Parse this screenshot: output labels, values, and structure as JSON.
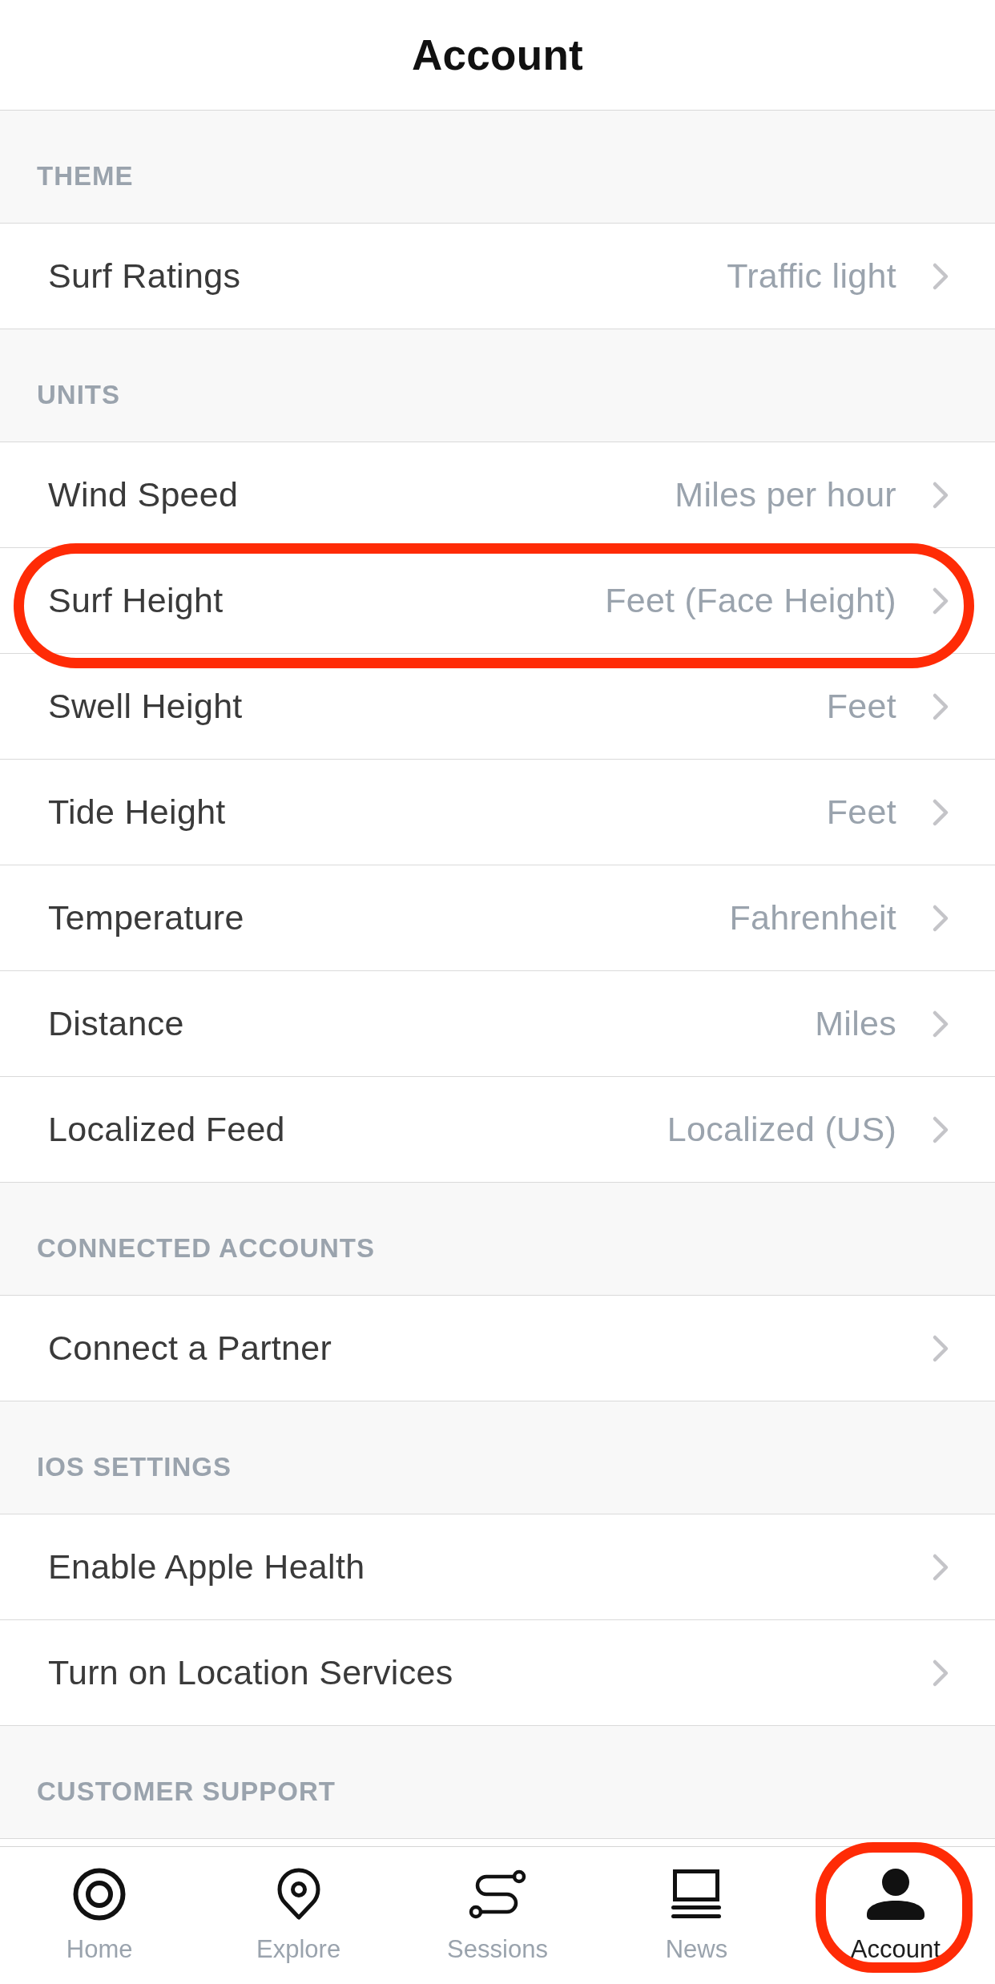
{
  "header": {
    "title": "Account"
  },
  "sections": [
    {
      "title": "THEME",
      "rows": [
        {
          "label": "Surf Ratings",
          "value": "Traffic light",
          "highlighted": false
        }
      ]
    },
    {
      "title": "UNITS",
      "rows": [
        {
          "label": "Wind Speed",
          "value": "Miles per hour",
          "highlighted": false
        },
        {
          "label": "Surf Height",
          "value": "Feet (Face Height)",
          "highlighted": true
        },
        {
          "label": "Swell Height",
          "value": "Feet",
          "highlighted": false
        },
        {
          "label": "Tide Height",
          "value": "Feet",
          "highlighted": false
        },
        {
          "label": "Temperature",
          "value": "Fahrenheit",
          "highlighted": false
        },
        {
          "label": "Distance",
          "value": "Miles",
          "highlighted": false
        },
        {
          "label": "Localized Feed",
          "value": "Localized (US)",
          "highlighted": false
        }
      ]
    },
    {
      "title": "CONNECTED ACCOUNTS",
      "rows": [
        {
          "label": "Connect a Partner",
          "highlighted": false
        }
      ]
    },
    {
      "title": "IOS SETTINGS",
      "rows": [
        {
          "label": "Enable Apple Health",
          "highlighted": false
        },
        {
          "label": "Turn on Location Services",
          "highlighted": false
        }
      ]
    },
    {
      "title": "CUSTOMER SUPPORT"
    }
  ],
  "tab_bar": {
    "tabs": [
      {
        "label": "Home",
        "selected": false,
        "highlighted": false
      },
      {
        "label": "Explore",
        "selected": false,
        "highlighted": false
      },
      {
        "label": "Sessions",
        "selected": false,
        "highlighted": false
      },
      {
        "label": "News",
        "selected": false,
        "highlighted": false
      },
      {
        "label": "Account",
        "selected": true,
        "highlighted": true
      }
    ]
  }
}
